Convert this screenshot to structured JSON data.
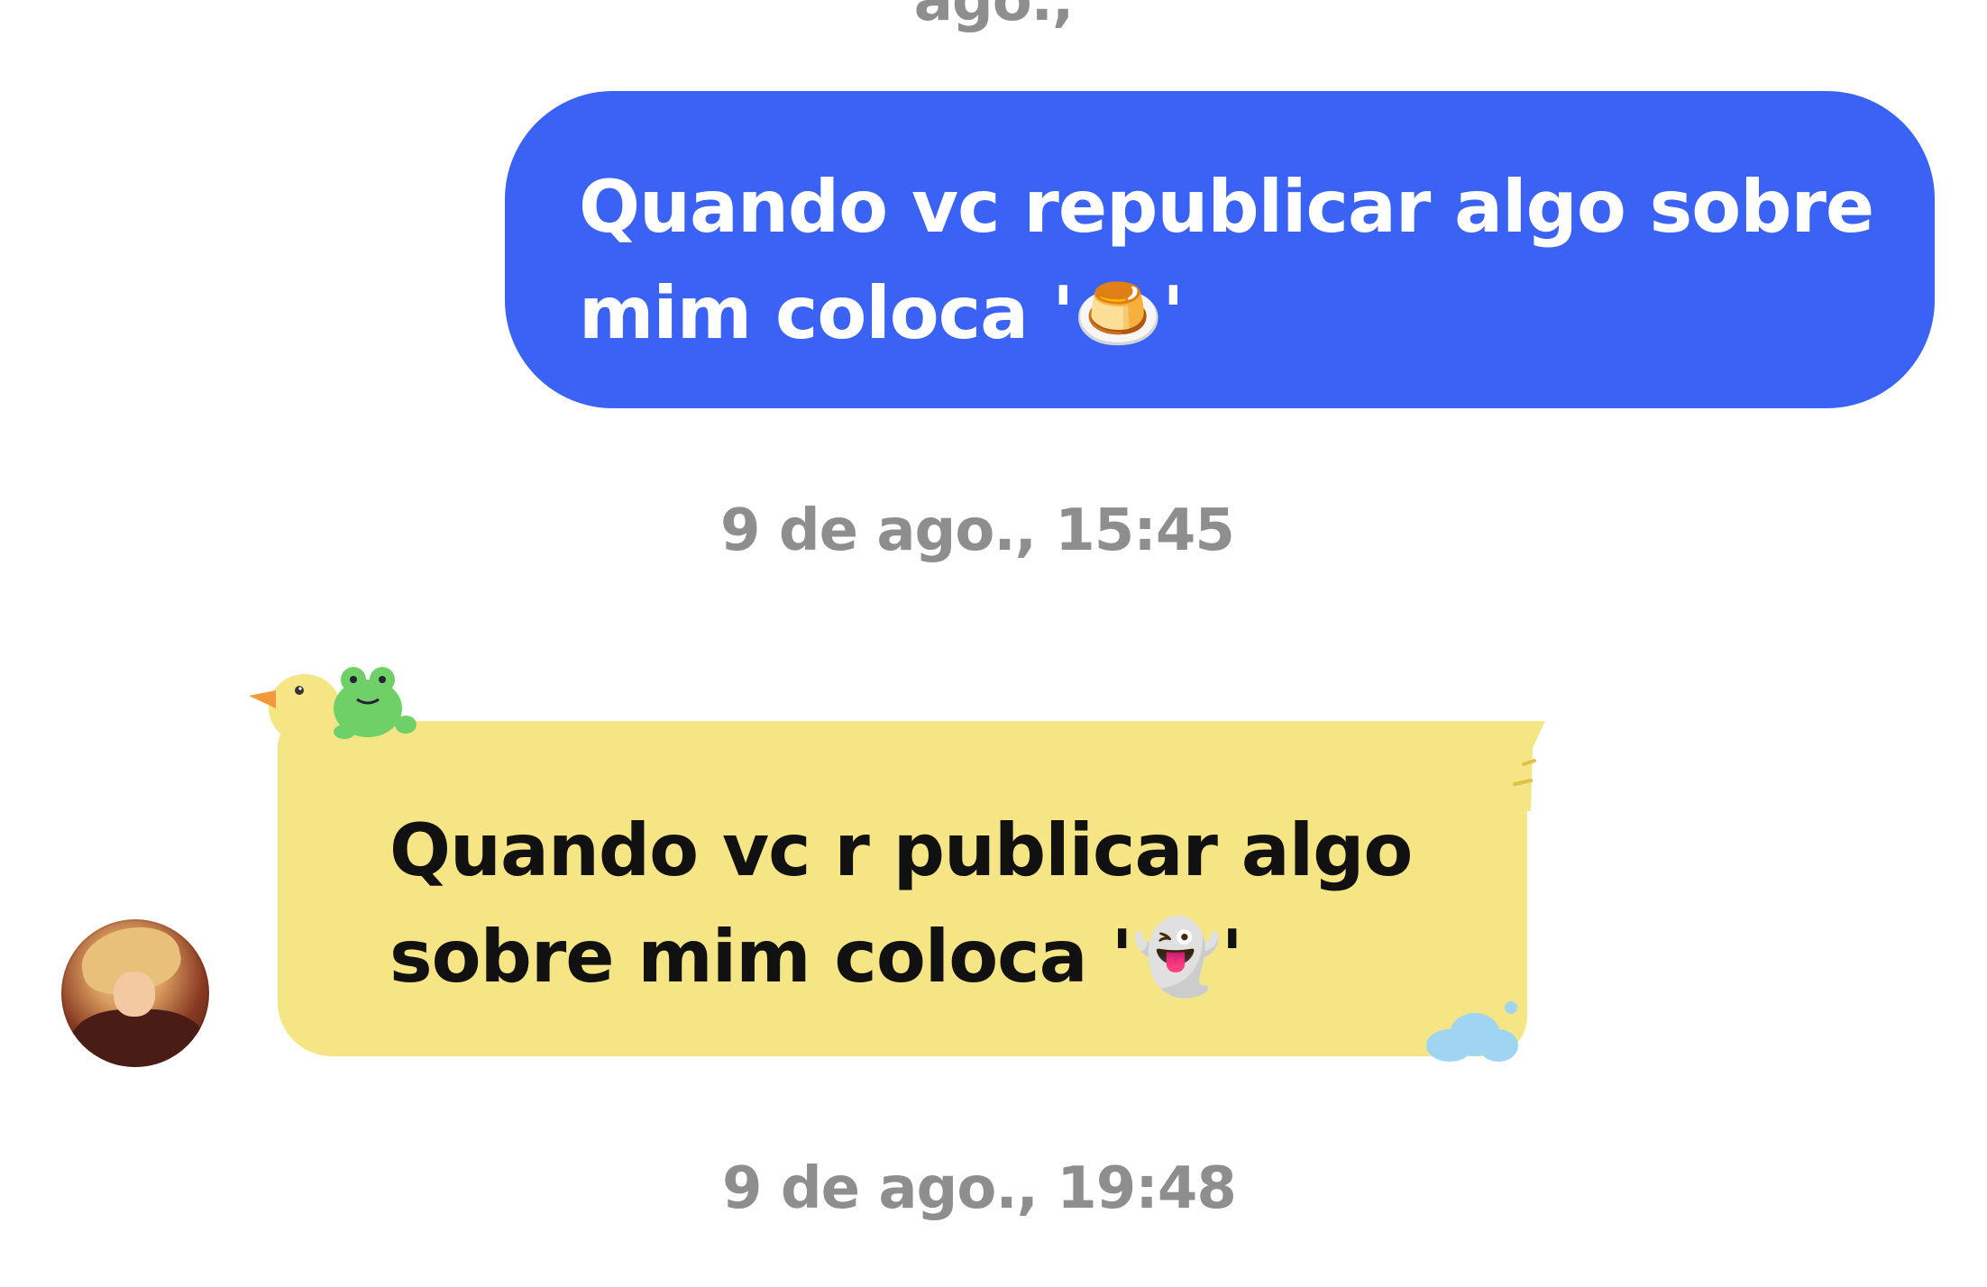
{
  "conversation": {
    "top_timestamp_partial": "ago.,",
    "sent_message": {
      "line1": "Quando vc republicar algo sobre",
      "line2": "mim coloca '🍮'"
    },
    "timestamp_1": "9 de ago., 15:45",
    "received_message": {
      "line1": "Quando vc r publicar algo",
      "line2": "sobre mim coloca '👻'"
    },
    "timestamp_2": "9 de ago., 19:48"
  },
  "colors": {
    "sent_bubble": "#3a62f5",
    "received_bubble": "#f6e584",
    "timestamp_text": "#8e8e8e"
  },
  "icons": {
    "bubble_decorations": [
      "duck-icon",
      "frog-icon",
      "cloud-icon"
    ],
    "avatar": "contact-avatar"
  }
}
